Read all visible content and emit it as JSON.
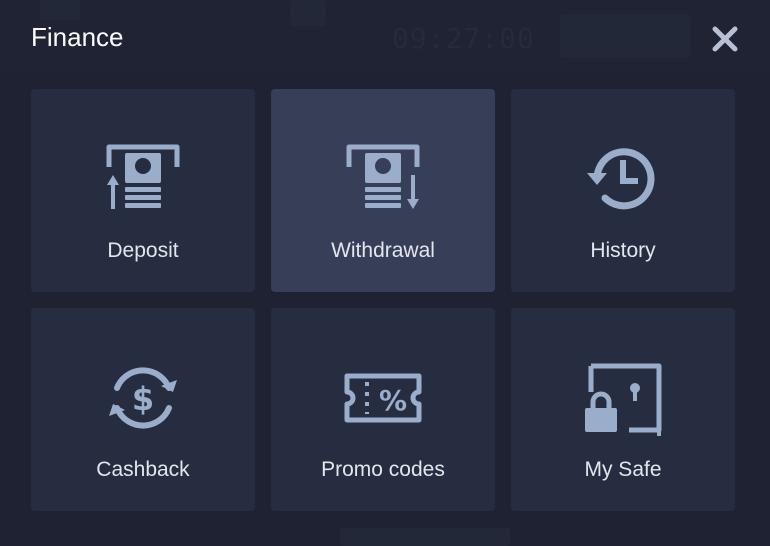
{
  "modal": {
    "title": "Finance",
    "close_icon": "close-icon"
  },
  "background": {
    "clock_text": "09:27:00"
  },
  "tiles": [
    {
      "label": "Deposit",
      "icon": "atm-deposit-icon",
      "active": false
    },
    {
      "label": "Withdrawal",
      "icon": "atm-withdrawal-icon",
      "active": true
    },
    {
      "label": "History",
      "icon": "history-clock-icon",
      "active": false
    },
    {
      "label": "Cashback",
      "icon": "cashback-dollar-icon",
      "active": false
    },
    {
      "label": "Promo codes",
      "icon": "promo-ticket-icon",
      "active": false
    },
    {
      "label": "My Safe",
      "icon": "safe-lock-icon",
      "active": false
    }
  ],
  "colors": {
    "backdrop": "#1e2232",
    "tile": "#272d40",
    "tile_active": "#373f58",
    "icon": "#9aaecb",
    "label": "#e3e6ee",
    "title": "#ffffff"
  }
}
